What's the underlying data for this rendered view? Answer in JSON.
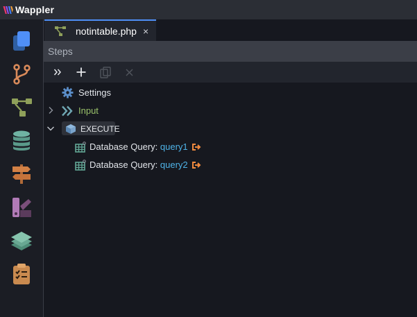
{
  "app": {
    "title": "Wappler"
  },
  "activity_bar": {
    "items": [
      {
        "name": "pages",
        "icon": "copy-icon"
      },
      {
        "name": "git",
        "icon": "git-branch-icon"
      },
      {
        "name": "server-connect",
        "icon": "workflow-icon"
      },
      {
        "name": "database",
        "icon": "database-icon"
      },
      {
        "name": "routing",
        "icon": "signpost-icon"
      },
      {
        "name": "design",
        "icon": "swatches-icon"
      },
      {
        "name": "layers",
        "icon": "layers-icon"
      },
      {
        "name": "tasks",
        "icon": "clipboard-check-icon"
      }
    ]
  },
  "tab": {
    "label": "notintable.php",
    "close": "×"
  },
  "panel": {
    "title": "Steps"
  },
  "toolbar": {
    "buttons": [
      {
        "name": "expand-all-button",
        "icon": "double-chevron-right-icon"
      },
      {
        "name": "add-step-button",
        "icon": "plus-icon"
      },
      {
        "name": "copy-step-button",
        "icon": "copy-icon"
      },
      {
        "name": "delete-step-button",
        "icon": "close-icon"
      }
    ]
  },
  "tree": {
    "settings": {
      "label": "Settings"
    },
    "input": {
      "label": "Input"
    },
    "execute": {
      "label": "EXECUTE"
    },
    "queries": [
      {
        "prefix": "Database Query: ",
        "name": "query1"
      },
      {
        "prefix": "Database Query: ",
        "name": "query2"
      }
    ]
  },
  "colors": {
    "accent": "#4f8ff7",
    "input_green": "#9bc36b",
    "query_link": "#4fb3e8",
    "output_arrow": "#f08a3e",
    "icon_olive": "#8fa05a",
    "icon_orange": "#c98a4f",
    "icon_teal": "#63a897"
  }
}
